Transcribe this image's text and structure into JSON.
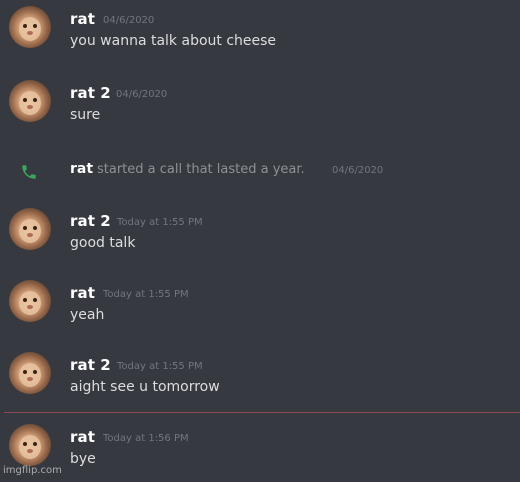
{
  "messages": [
    {
      "user": "rat",
      "timestamp": "04/6/2020",
      "text": "you wanna talk about cheese"
    },
    {
      "user": "rat 2",
      "timestamp": "04/6/2020",
      "text": "sure"
    },
    {
      "user": "rat 2",
      "timestamp": "Today at 1:55 PM",
      "text": "good talk"
    },
    {
      "user": "rat",
      "timestamp": "Today at 1:55 PM",
      "text": "yeah"
    },
    {
      "user": "rat 2",
      "timestamp": "Today at 1:55 PM",
      "text": "aight see u tomorrow"
    },
    {
      "user": "rat",
      "timestamp": "Today at 1:56 PM",
      "text": "bye"
    }
  ],
  "call": {
    "user": "rat",
    "text": "started a call that lasted a year.",
    "timestamp": "04/6/2020",
    "icon": "phone-icon"
  },
  "watermark": "imgflip.com",
  "colors": {
    "background": "#36393f",
    "username": "#ffffff",
    "message_text": "#dcddde",
    "timestamp": "#72767d",
    "call_icon": "#3ba55d",
    "new_divider": "#8a4a4f"
  }
}
